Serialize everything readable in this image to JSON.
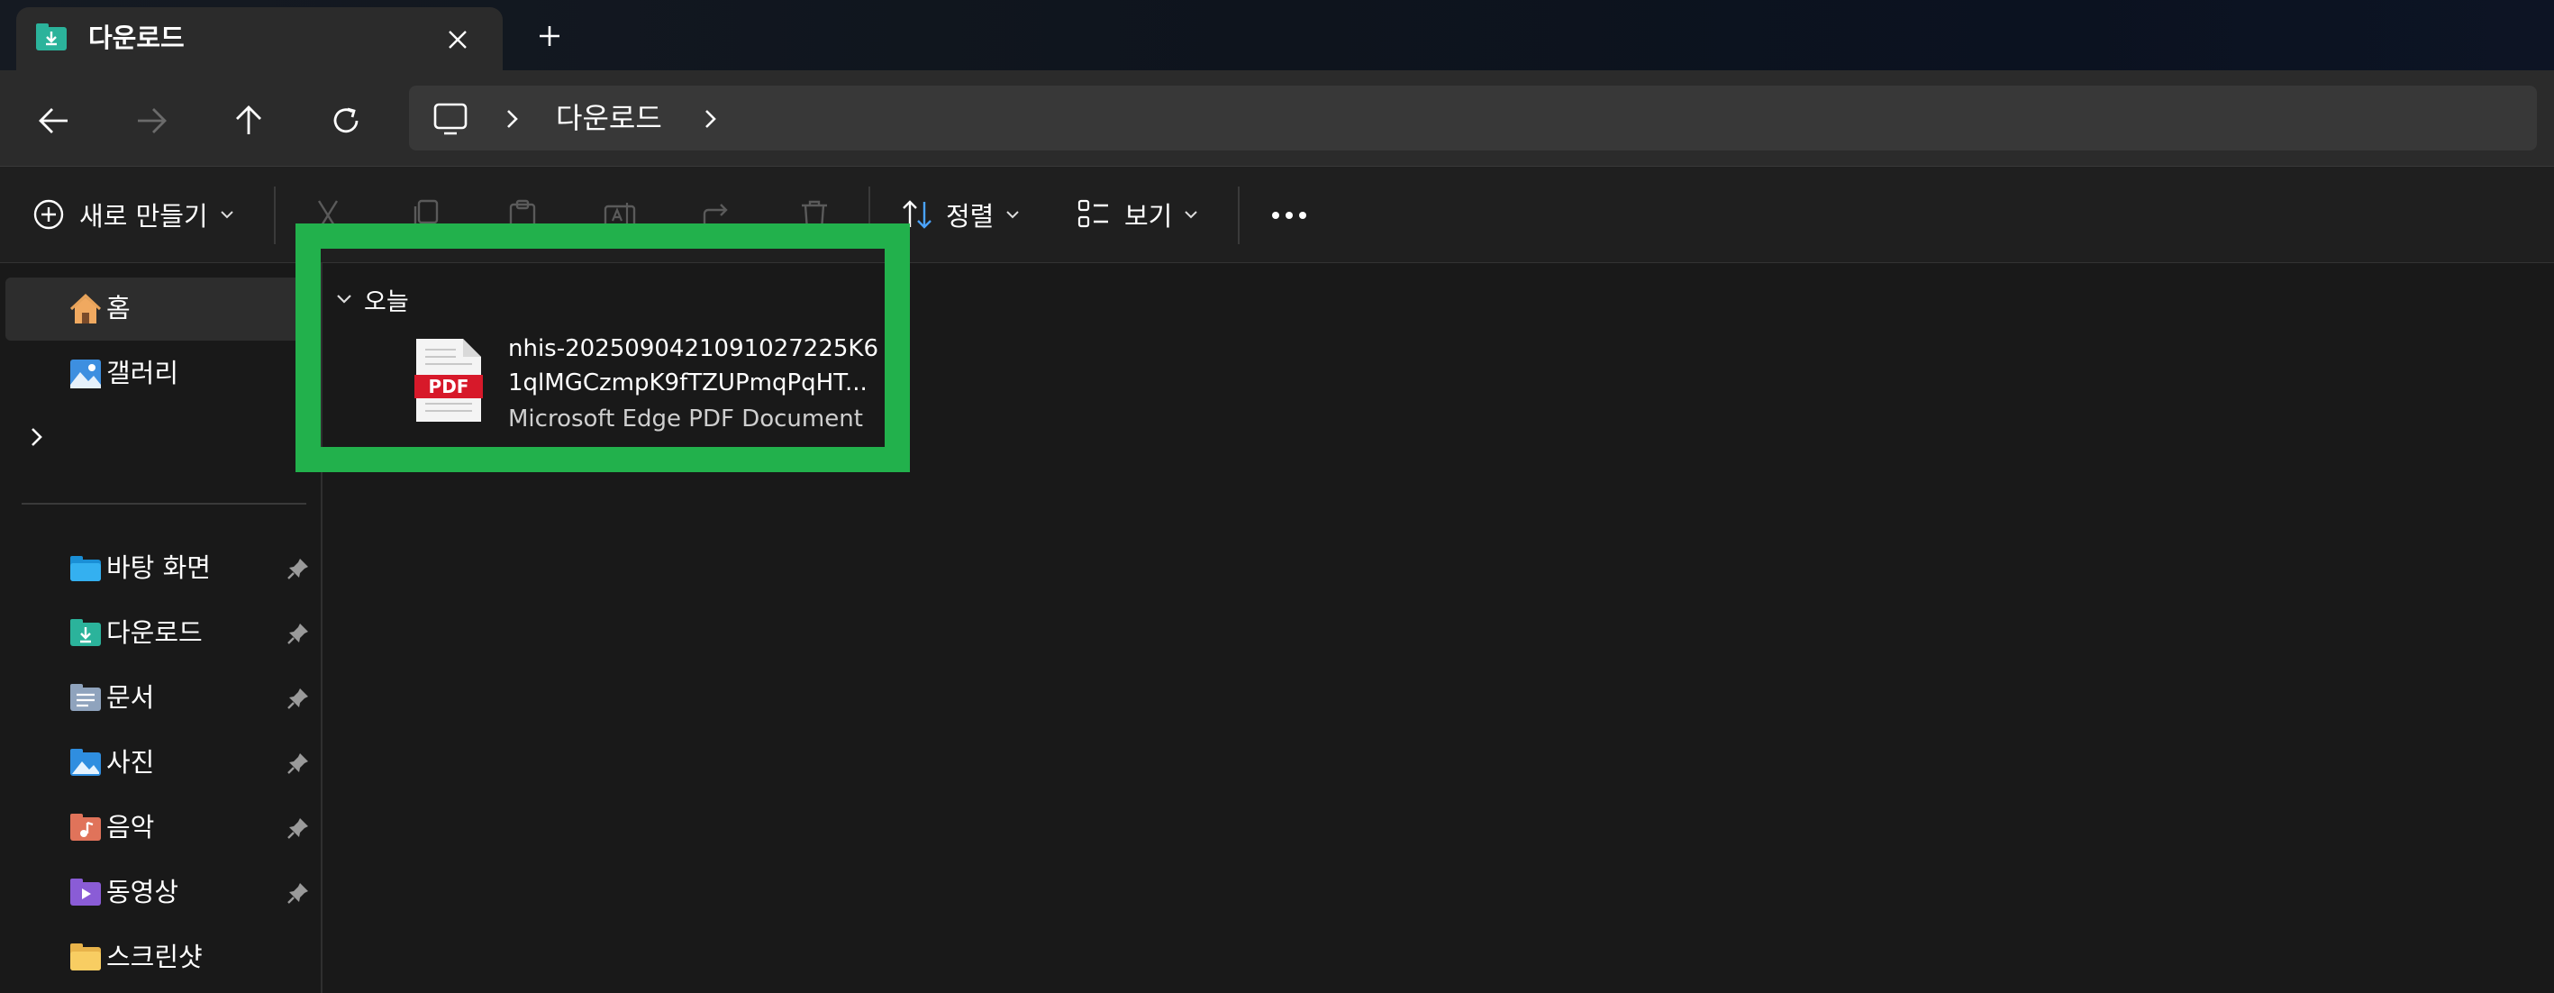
{
  "tab": {
    "title": "다운로드",
    "icon": "download-folder-icon"
  },
  "nav": {
    "breadcrumb": "다운로드"
  },
  "commandbar": {
    "new_label": "새로 만들기",
    "sort_label": "정렬",
    "view_label": "보기"
  },
  "sidebar": {
    "top_items": [
      {
        "label": "홈",
        "icon": "home-icon"
      },
      {
        "label": "갤러리",
        "icon": "gallery-icon"
      }
    ],
    "pinned": [
      {
        "label": "바탕 화면",
        "icon": "desktop-folder-icon"
      },
      {
        "label": "다운로드",
        "icon": "download-folder-icon"
      },
      {
        "label": "문서",
        "icon": "documents-folder-icon"
      },
      {
        "label": "사진",
        "icon": "pictures-folder-icon"
      },
      {
        "label": "음악",
        "icon": "music-folder-icon"
      },
      {
        "label": "동영상",
        "icon": "videos-folder-icon"
      },
      {
        "label": "스크린샷",
        "icon": "folder-icon"
      }
    ]
  },
  "content": {
    "group_label": "오늘",
    "file": {
      "name_line1": "nhis-2025090421091027225K6",
      "name_line2": "1qlMGCzmpK9fTZUPmqPqHT...",
      "type": "Microsoft Edge PDF Document",
      "icon": "pdf-file-icon",
      "badge": "PDF"
    }
  },
  "colors": {
    "highlight": "#22b14c",
    "pdf_red": "#d7192a",
    "folder_teal": "#2bb39b"
  }
}
